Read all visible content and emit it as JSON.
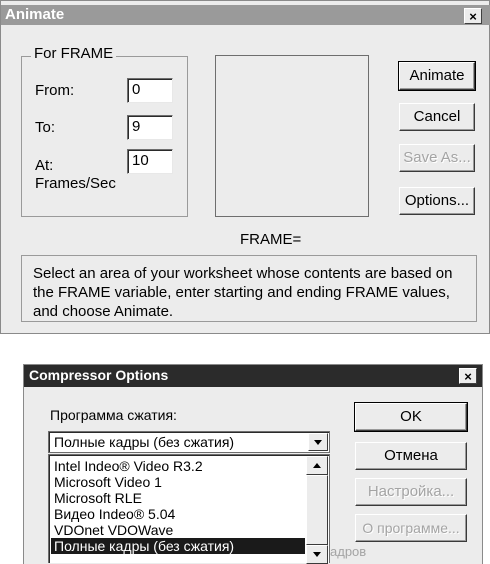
{
  "animate": {
    "title": "Animate",
    "close": "×",
    "group_label": "For FRAME",
    "from_label": "From:",
    "from_value": "0",
    "to_label": "To:",
    "to_value": "9",
    "at_label": "At:",
    "at_value": "10",
    "rate_label": "Frames/Sec",
    "frame_label": "FRAME=",
    "buttons": {
      "animate": "Animate",
      "cancel": "Cancel",
      "save_as": "Save As...",
      "options": "Options..."
    },
    "hint": "Select an area of your worksheet whose contents are based on the FRAME variable, enter starting and ending FRAME values, and choose Animate."
  },
  "compressor": {
    "title": "Compressor Options",
    "close": "×",
    "program_label": "Программа сжатия:",
    "selected": "Полные кадры (без сжатия)",
    "items": [
      "Intel Indeo® Video R3.2",
      "Microsoft Video 1",
      "Microsoft RLE",
      "Видео Indeo® 5.04",
      "VDOnet VDOWave",
      "Полные кадры (без сжатия)"
    ],
    "selected_index": 5,
    "partial_text": "адров",
    "buttons": {
      "ok": "OK",
      "cancel": "Отмена",
      "settings": "Настройка...",
      "about": "О программе..."
    }
  }
}
